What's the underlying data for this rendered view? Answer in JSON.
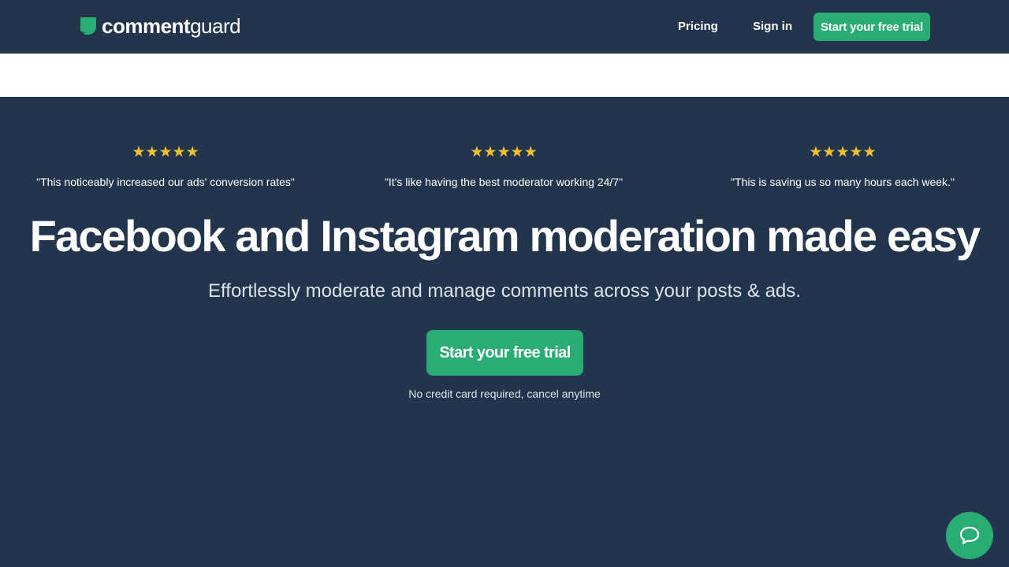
{
  "nav": {
    "logo_bold": "comment",
    "logo_light": "guard",
    "links": [
      {
        "label": "Pricing"
      },
      {
        "label": "Sign in"
      }
    ],
    "cta_label": "Start your free trial"
  },
  "testimonials": [
    {
      "stars": 5,
      "quote": "\"This noticeably increased our ads' conversion rates\""
    },
    {
      "stars": 5,
      "quote": "\"It's like having the best moderator working 24/7\""
    },
    {
      "stars": 5,
      "quote": "\"This is saving us so many hours each week.\""
    }
  ],
  "hero": {
    "headline": "Facebook and Instagram moderation made easy",
    "subheadline": "Effortlessly moderate and manage comments across your posts & ads.",
    "cta_label": "Start your free trial",
    "note": "No credit card required, cancel anytime"
  },
  "colors": {
    "background": "#23354d",
    "accent": "#2aad74",
    "star": "#f2c12e"
  },
  "icons": {
    "logo": "chat-bubble-logo-icon",
    "star": "star-icon",
    "chat": "chat-icon"
  }
}
